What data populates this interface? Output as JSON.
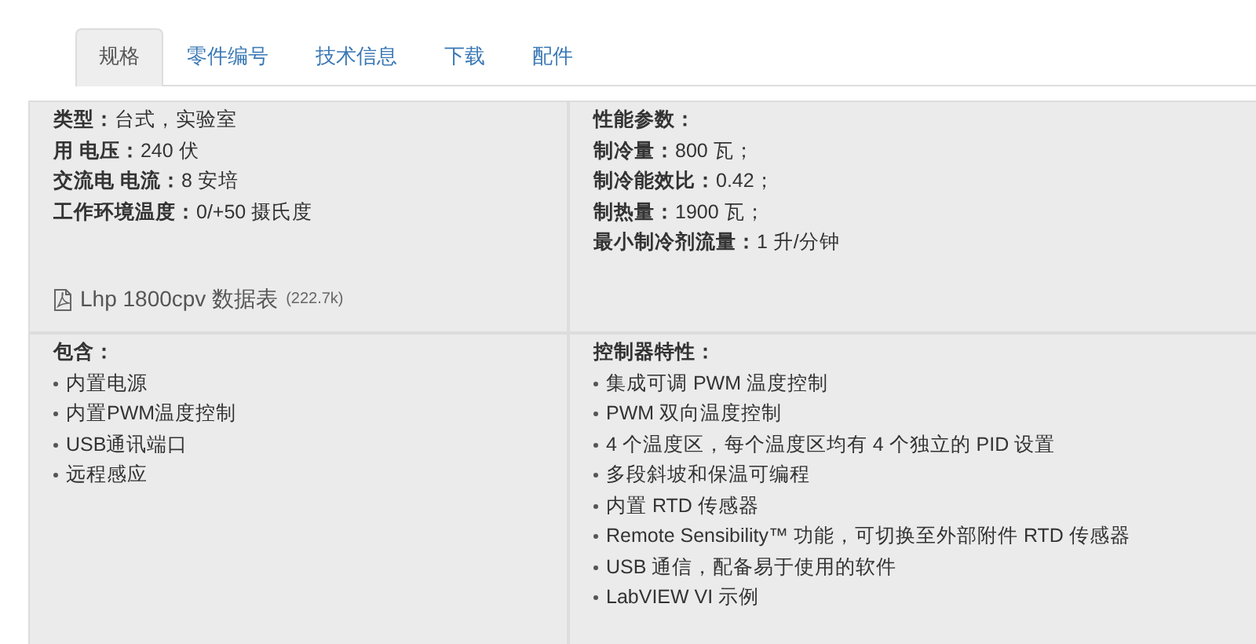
{
  "tabs": [
    {
      "label": "规格",
      "selected": true
    },
    {
      "label": "零件编号",
      "selected": false
    },
    {
      "label": "技术信息",
      "selected": false
    },
    {
      "label": "下载",
      "selected": false
    },
    {
      "label": "配件",
      "selected": false
    }
  ],
  "specs": {
    "lines": [
      "**类型：**台式，实验室",
      "**用 电压：**240 伏",
      "**交流电 电流：**8 安培",
      "**工作环境温度：**0/+50 摄氏度"
    ],
    "download": {
      "label": "Lhp 1800cpv 数据表",
      "size": "(222.7k)"
    }
  },
  "performance": {
    "heading": "性能参数：",
    "lines": [
      "**制冷量：**800 瓦；",
      "**制冷能效比：**0.42；",
      "**制热量：**1900 瓦；",
      "**最小制冷剂流量：**1 升/分钟"
    ]
  },
  "includes": {
    "heading": "包含：",
    "items": [
      "内置电源",
      "内置PWM温度控制",
      "USB通讯端口",
      "远程感应"
    ]
  },
  "controller": {
    "heading": "控制器特性：",
    "items": [
      "集成可调 PWM 温度控制",
      "PWM 双向温度控制",
      "4 个温度区，每个温度区均有 4 个独立的 PID 设置",
      "多段斜坡和保温可编程",
      "内置 RTD 传感器",
      "Remote Sensibility™ 功能，可切换至外部附件 RTD 传感器",
      "USB 通信，配备易于使用的软件",
      "LabVIEW VI 示例"
    ]
  }
}
